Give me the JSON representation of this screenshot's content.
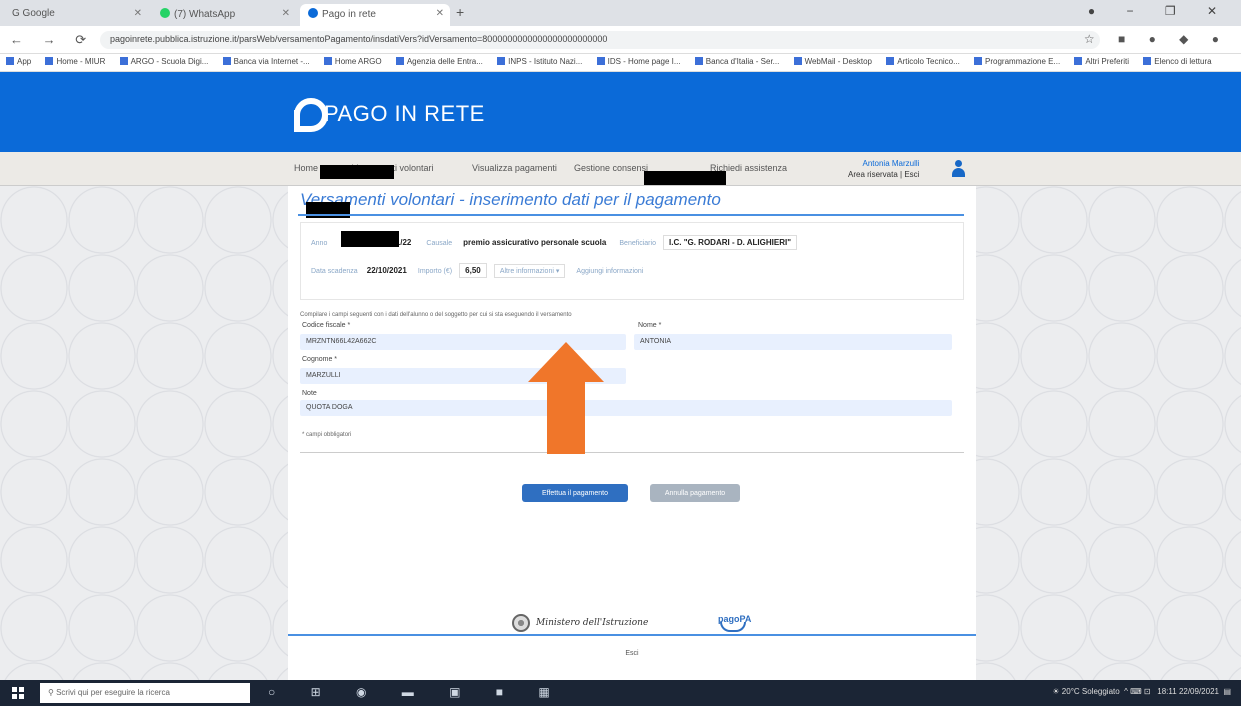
{
  "browser": {
    "tabs": [
      {
        "label": "G  Google",
        "active": false
      },
      {
        "label": "(7) WhatsApp",
        "active": false
      },
      {
        "label": "Pago in rete",
        "active": true
      }
    ],
    "url": "pagoinrete.pubblica.istruzione.it/parsWeb/versamentoPagamento/insdatiVers?idVersamento=8000000000000000000000000",
    "bookmarks": [
      "App",
      "Home - MIUR",
      "ARGO - Scuola Digi...",
      "Banca via Internet -...",
      "Home ARGO",
      "Agenzia delle Entra...",
      "INPS - Istituto Nazi...",
      "IDS - Home page I...",
      "Banca d'Italia - Ser...",
      "WebMail - Desktop",
      "Articolo Tecnico...",
      "Programmazione E...",
      "Altri Preferiti",
      "Elenco di lettura"
    ]
  },
  "header": {
    "logo_text": "PAGO IN RETE"
  },
  "nav": {
    "items": [
      "Home",
      "Versamenti volontari",
      "Visualizza pagamenti",
      "Gestione consensi",
      "Richiedi assistenza"
    ],
    "user_name": "Antonia Marzulli",
    "user_area": "Area riservata | Esci"
  },
  "page": {
    "title": "Versamenti volontari - inserimento dati per il pagamento"
  },
  "payment": {
    "year_label": "Anno",
    "year_value": "2021/22",
    "causale_label": "Causale",
    "causale_value": "premio assicurativo personale scuola",
    "beneficiario_label": "Beneficiario",
    "beneficiario_value": "I.C. \"G. RODARI - D. ALIGHIERI\"",
    "scadenza_label": "Data scadenza",
    "scadenza_value": "22/10/2021",
    "importo_label": "Importo (€)",
    "importo_value": "6,50",
    "dropdown_placeholder": "Altre informazioni",
    "link_label": "Aggiungi informazioni"
  },
  "form": {
    "instructions": "Compilare i campi seguenti con i dati dell'alunno o del soggetto per cui si sta eseguendo il versamento",
    "codice_fiscale_label": "Codice fiscale *",
    "codice_fiscale_value": "MRZNTN66L42A662C",
    "nome_label": "Nome *",
    "nome_value": "ANTONIA",
    "cognome_label": "Cognome *",
    "cognome_value": "MARZULLI",
    "note_label": "Note",
    "note_value": "QUOTA DOGA",
    "required_note": "* campi obbligatori"
  },
  "actions": {
    "pay_label": "Effettua il pagamento",
    "cancel_label": "Annulla pagamento"
  },
  "footer": {
    "ministry": "Ministero dell'Istruzione",
    "pagopa": "pagoPA",
    "text": "Esci"
  },
  "taskbar": {
    "search_placeholder": "Scrivi qui per eseguire la ricerca",
    "weather": "20°C Soleggiato",
    "time": "18:11",
    "date": "22/09/2021"
  },
  "colors": {
    "brand_blue": "#0b6ad8",
    "arrow_orange": "#f0762a",
    "field_bg": "#e8f0fe"
  }
}
